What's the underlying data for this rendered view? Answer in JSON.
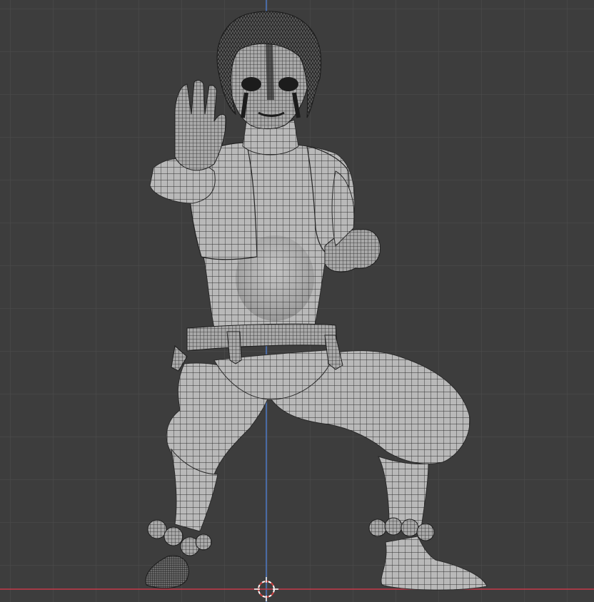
{
  "viewport": {
    "background_color": "#3d3d3d",
    "grid_color": "#4a4a4a",
    "x_axis_color": "#c63a4a",
    "z_axis_color": "#4f7ed1",
    "mesh_fill_color": "#b7b7b7",
    "wire_color": "#2b2b2b"
  },
  "scene": {
    "object": "character-mesh",
    "display_mode": "wireframe-overlay",
    "cursor_icon": "3d-cursor-icon"
  }
}
